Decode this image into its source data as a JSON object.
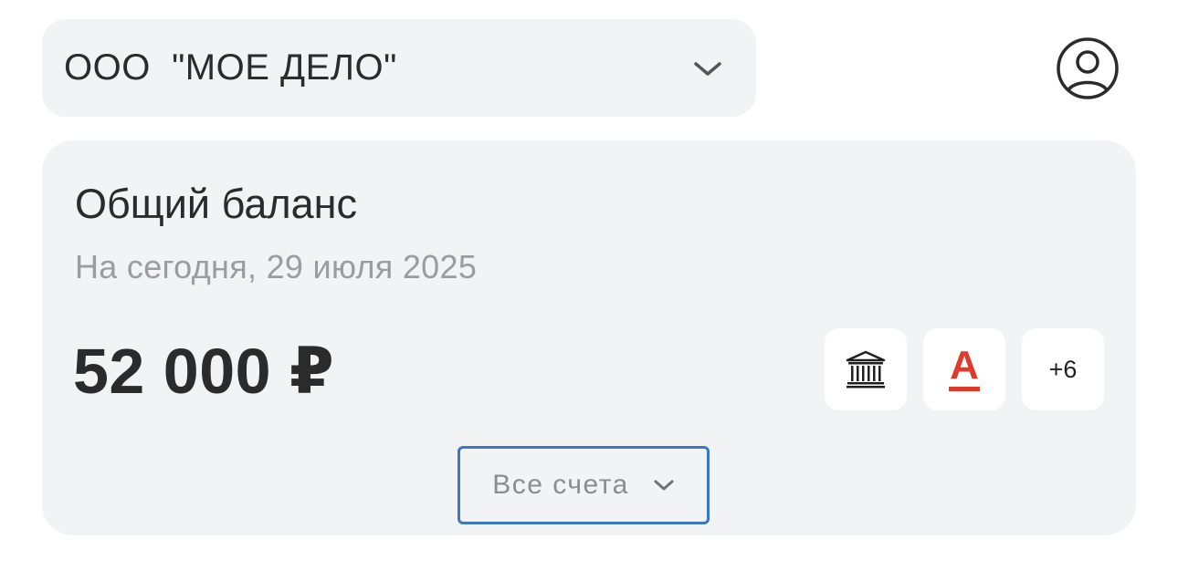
{
  "header": {
    "company_name": "ООО  \"МОЕ ДЕЛО\"",
    "company_chevron_icon": "chevron-down-icon",
    "profile_icon": "user-circle-icon"
  },
  "balance": {
    "title": "Общий баланс",
    "date_label": "На сегодня, 29 июля 2025",
    "amount": "52 000 ₽",
    "bank_tiles": [
      {
        "icon": "bank-building-icon"
      },
      {
        "icon": "alfa-bank-logo",
        "logo_letter": "А",
        "color": "#e03a2d"
      },
      {
        "label": "+6"
      }
    ],
    "accounts_button": {
      "label": "Все счета",
      "icon": "chevron-down-icon",
      "border_color": "#3a78c2"
    }
  }
}
